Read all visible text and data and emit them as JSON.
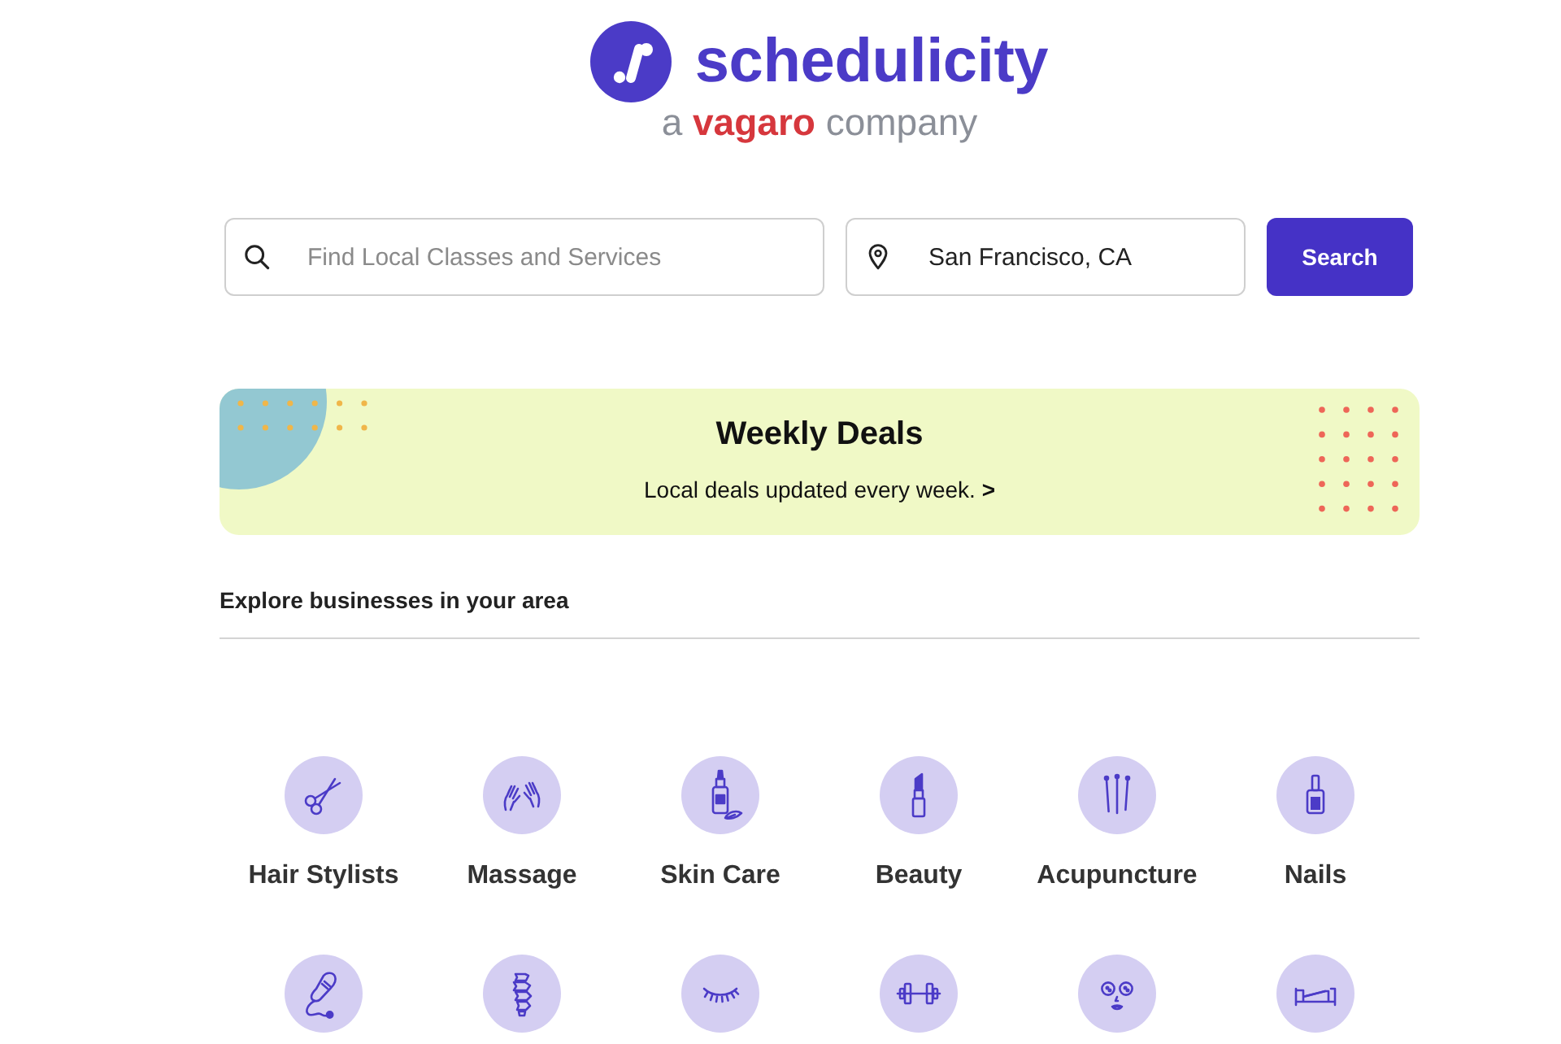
{
  "logo": {
    "wordmark": "schedulicity",
    "tagline": [
      {
        "text": "a",
        "kind": "plain"
      },
      {
        "text": "vagaro",
        "kind": "brand"
      },
      {
        "text": "company",
        "kind": "plain"
      }
    ]
  },
  "search": {
    "query": {
      "placeholder": "Find Local Classes and Services"
    },
    "location": {
      "value": "San Francisco, CA"
    },
    "button": "Search"
  },
  "deals_banner": {
    "title": "Weekly Deals",
    "link": "Local deals updated every week. **>**"
  },
  "explore": {
    "heading": "Explore businesses in your area",
    "categories": [
      {
        "label": "Hair Stylists"
      },
      {
        "label": "Massage"
      },
      {
        "label": "Skin Care"
      },
      {
        "label": "Beauty"
      },
      {
        "label": "Acupuncture"
      },
      {
        "label": "Nails"
      }
    ]
  }
}
